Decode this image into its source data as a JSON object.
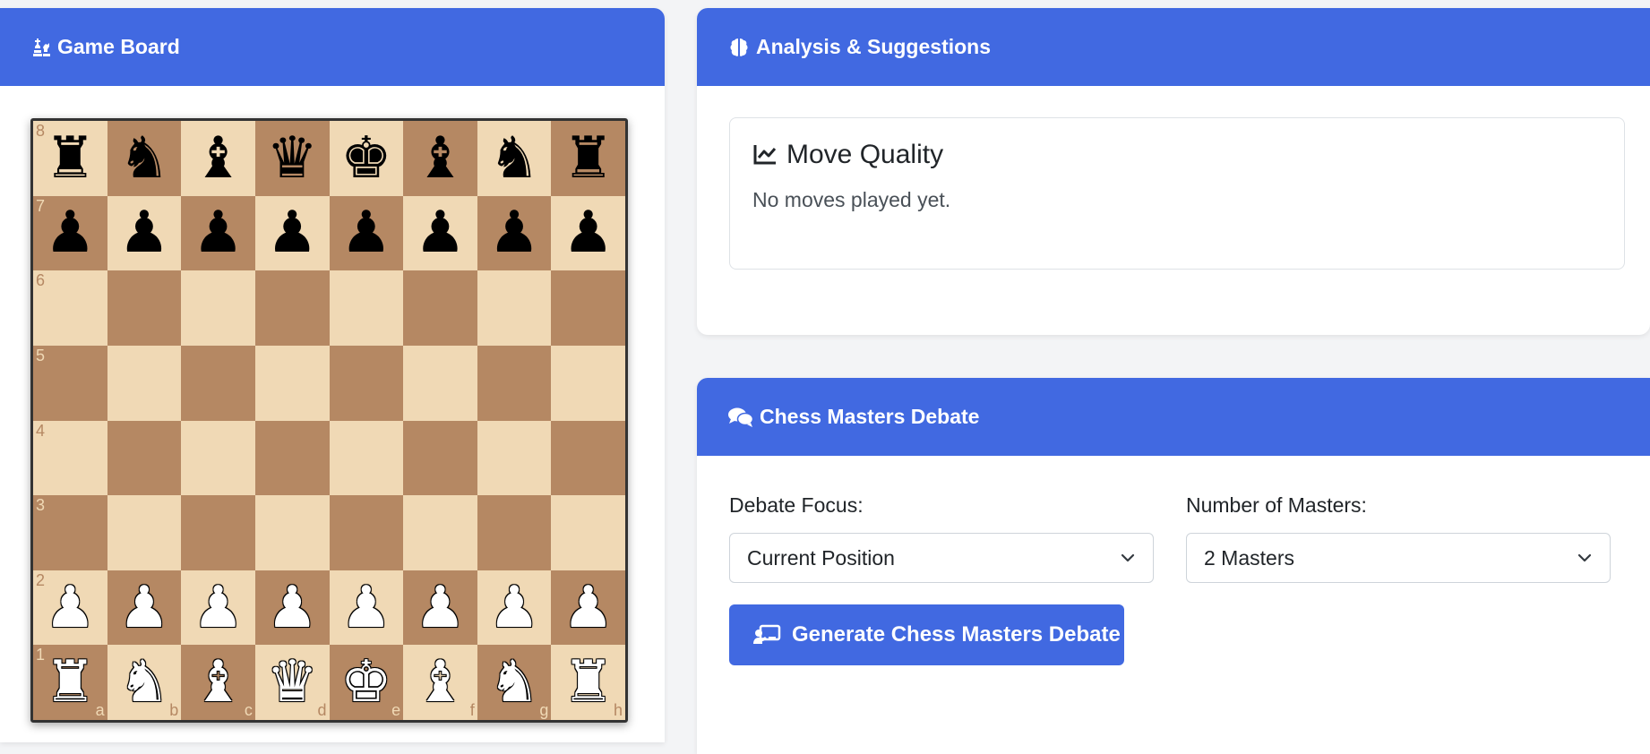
{
  "board_panel": {
    "title": "Game Board",
    "icon": "chess-pieces-icon"
  },
  "board": {
    "colors": {
      "light": "#f0d9b5",
      "dark": "#b58863"
    },
    "files": [
      "a",
      "b",
      "c",
      "d",
      "e",
      "f",
      "g",
      "h"
    ],
    "ranks": [
      "8",
      "7",
      "6",
      "5",
      "4",
      "3",
      "2",
      "1"
    ],
    "position": [
      [
        "bR",
        "bN",
        "bB",
        "bQ",
        "bK",
        "bB",
        "bN",
        "bR"
      ],
      [
        "bP",
        "bP",
        "bP",
        "bP",
        "bP",
        "bP",
        "bP",
        "bP"
      ],
      [
        "",
        "",
        "",
        "",
        "",
        "",
        "",
        ""
      ],
      [
        "",
        "",
        "",
        "",
        "",
        "",
        "",
        ""
      ],
      [
        "",
        "",
        "",
        "",
        "",
        "",
        "",
        ""
      ],
      [
        "",
        "",
        "",
        "",
        "",
        "",
        "",
        ""
      ],
      [
        "wP",
        "wP",
        "wP",
        "wP",
        "wP",
        "wP",
        "wP",
        "wP"
      ],
      [
        "wR",
        "wN",
        "wB",
        "wQ",
        "wK",
        "wB",
        "wN",
        "wR"
      ]
    ]
  },
  "analysis_panel": {
    "title": "Analysis & Suggestions",
    "icon": "brain-icon",
    "move_quality": {
      "title": "Move Quality",
      "icon": "chart-line-icon",
      "text": "No moves played yet."
    }
  },
  "debate_panel": {
    "title": "Chess Masters Debate",
    "icon": "comments-icon",
    "focus_label": "Debate Focus:",
    "focus_value": "Current Position",
    "masters_label": "Number of Masters:",
    "masters_value": "2 Masters",
    "generate_button": "Generate Chess Masters Debate",
    "button_icon": "chalkboard-teacher-icon"
  },
  "theme": {
    "accent": "#4169e1"
  }
}
